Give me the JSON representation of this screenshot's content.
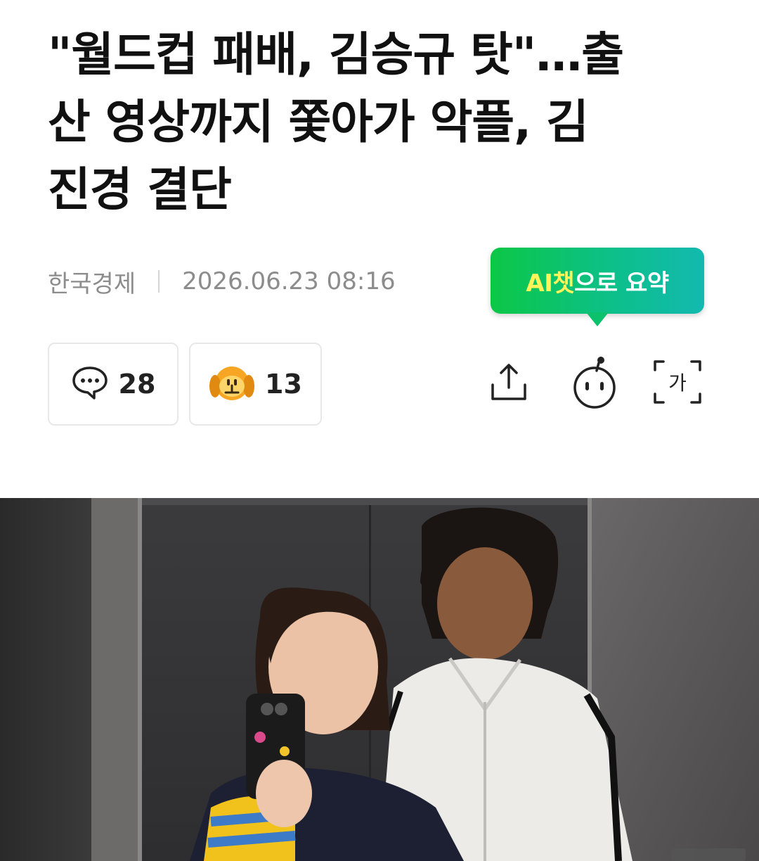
{
  "article": {
    "headline_line1": "\"월드컵 패배, 김승규 탓\"…출",
    "headline_line2": "산 영상까지 쫓아가 악플, 김",
    "headline_line3": "진경 결단",
    "source": "한국경제",
    "datetime": "2026.06.23 08:16"
  },
  "ai_summary": {
    "label_highlight": "AI챗",
    "label_rest": "으로 요약"
  },
  "stats": {
    "comments_count": "28",
    "reactions_count": "13"
  },
  "toolbar": {
    "font_size_glyph": "가"
  },
  "icons": {
    "comment": "speech-bubble-icon",
    "reaction": "dog-face-emoji-icon",
    "share": "share-icon",
    "bot": "robot-icon",
    "font": "font-size-icon"
  },
  "colors": {
    "accent_green": "#0cc746",
    "accent_teal": "#13b9b0",
    "highlight_yellow": "#fff45a",
    "reaction_orange": "#f6a623"
  }
}
